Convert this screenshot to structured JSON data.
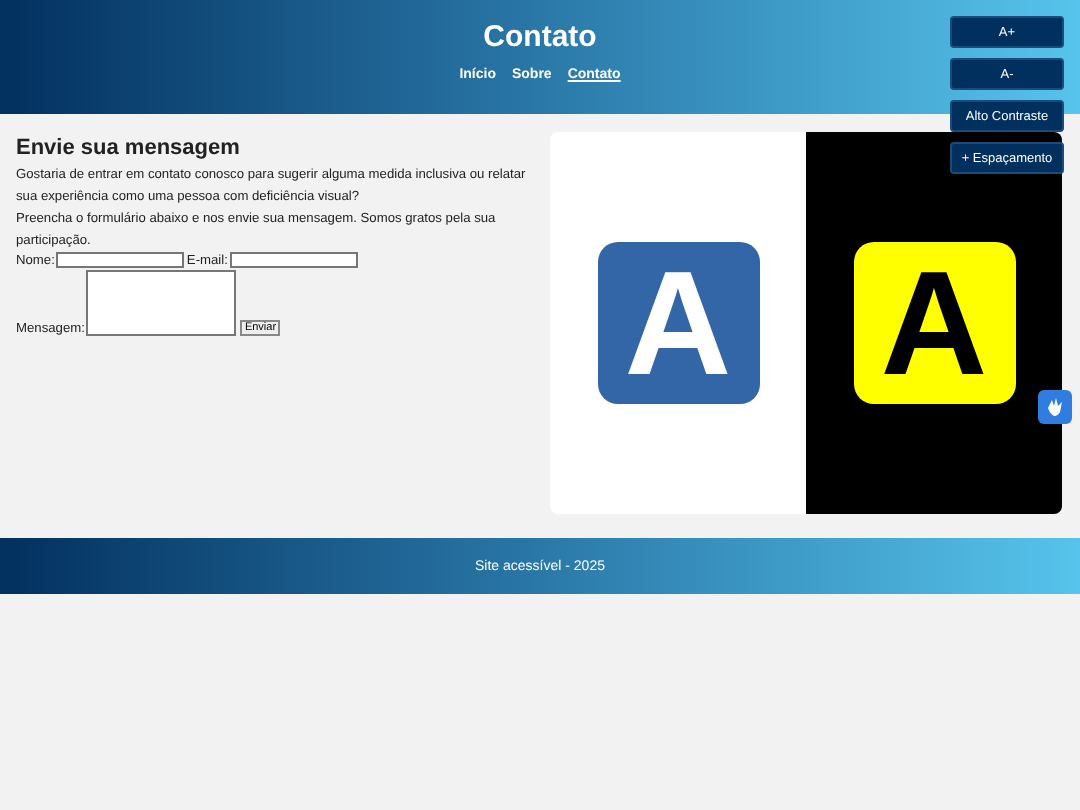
{
  "header": {
    "title": "Contato",
    "nav": [
      {
        "label": "Início",
        "selected": false
      },
      {
        "label": "Sobre",
        "selected": false
      },
      {
        "label": "Contato",
        "selected": true
      }
    ]
  },
  "accessibility_buttons": [
    "A+",
    "A-",
    "Alto Contraste",
    "+ Espaçamento"
  ],
  "form": {
    "heading": "Envie sua mensagem",
    "paragraphs": [
      "Gostaria de entrar em contato conosco para sugerir alguma medida inclusiva ou relatar sua experiência como uma pessoa com deficiência visual?",
      "Preencha o formulário abaixo e nos envie sua mensagem. Somos gratos pela sua participação."
    ],
    "name_label": "Nome:",
    "email_label": "E-mail:",
    "message_label": "Mensagem:",
    "submit": "Enviar"
  },
  "illustration": {
    "letters": [
      "A",
      "A"
    ]
  },
  "footer": "Site acessível - 2025"
}
